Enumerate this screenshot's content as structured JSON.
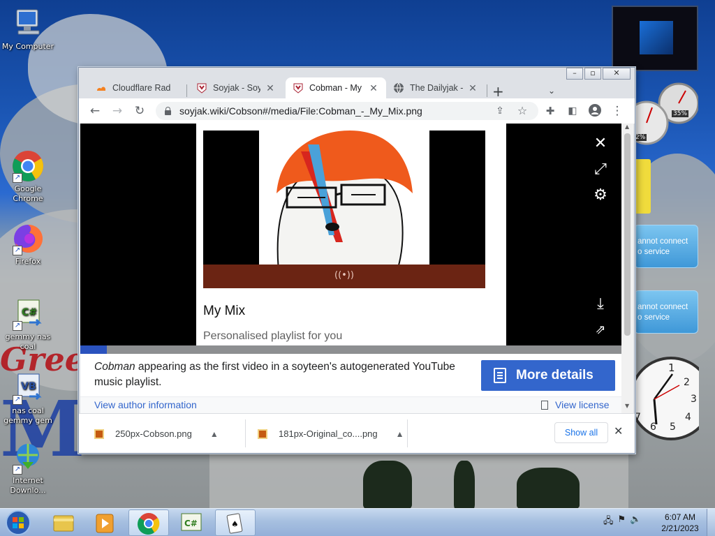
{
  "desktop": {
    "icons": [
      {
        "label": "My Computer",
        "icon": "computer-icon"
      },
      {
        "label": "Google Chrome",
        "icon": "chrome-icon"
      },
      {
        "label": "Firefox",
        "icon": "firefox-icon"
      },
      {
        "label": "gemmy nas coal",
        "icon": "csharp-project-icon"
      },
      {
        "label": "nas coal gemmy gem",
        "icon": "vb-project-icon"
      },
      {
        "label": "Internet Downlo...",
        "icon": "internet-download-manager-icon"
      }
    ],
    "gadgets": {
      "cpu_meter_1": "2%",
      "cpu_meter_2": "35%",
      "notification_1": "annot connect\no service",
      "notification_2": "annot connect\no service"
    }
  },
  "browser": {
    "tabs": [
      {
        "title": "Cloudflare Rad",
        "icon": "cloudflare-icon",
        "active": false
      },
      {
        "title": "Soyjak - Soyja",
        "icon": "soyjak-wiki-icon",
        "active": false
      },
      {
        "title": "Cobman - My",
        "icon": "soyjak-wiki-icon",
        "active": true
      },
      {
        "title": "The Dailyjak -",
        "icon": "globe-icon",
        "active": false
      }
    ],
    "new_tab_label": "+",
    "url": "soyjak.wiki/Cobson#/media/File:Cobman_-_My_Mix.png",
    "media_viewer": {
      "card_title": "My Mix",
      "card_subtitle": "Personalised playlist for you",
      "caption_italic": "Cobman",
      "caption_rest": " appearing as the first video in a soyteen's autogenerated YouTube music playlist.",
      "more_details_label": "More details",
      "view_author_label": "View author information",
      "view_license_label": "View license"
    },
    "downloads": [
      {
        "filename": "250px-Cobson.png"
      },
      {
        "filename": "181px-Original_co....png"
      }
    ],
    "show_all_label": "Show all"
  },
  "taskbar": {
    "time": "6:07 AM",
    "date": "2/21/2023",
    "apps": [
      "file-explorer-icon",
      "media-player-icon",
      "chrome-icon",
      "csharp-project-icon",
      "solitaire-icon"
    ]
  },
  "colors": {
    "accent_blue": "#3366cc",
    "progress_blue": "#2a52be",
    "tab_strip": "#dee1e6"
  }
}
